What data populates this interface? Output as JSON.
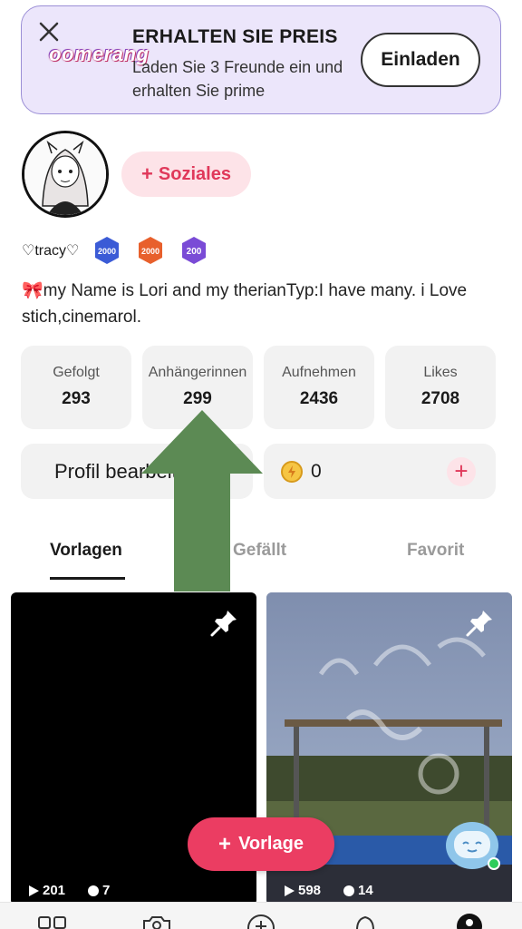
{
  "promo": {
    "logo_text": "oomerang",
    "title": "ERHALTEN SIE PREIS",
    "subtitle": "Laden Sie 3 Freunde ein und erhalten Sie prime",
    "button_label": "Einladen"
  },
  "profile": {
    "social_label": "Soziales",
    "username": "♡tracy♡",
    "badges": [
      {
        "label": "2000",
        "color": "#3b5bd6"
      },
      {
        "label": "2000",
        "color": "#e8602c"
      },
      {
        "label": "200",
        "color": "#7a4bd6"
      }
    ],
    "bio": "🎀my Name is Lori and my therianTyp:I have many. i Love stich,cinemarol."
  },
  "stats": [
    {
      "label": "Gefolgt",
      "value": "293"
    },
    {
      "label": "Anhängerinnen",
      "value": "299"
    },
    {
      "label": "Aufnehmen",
      "value": "2436"
    },
    {
      "label": "Likes",
      "value": "2708"
    }
  ],
  "actions": {
    "edit_label": "Profil bearbeiten",
    "coins": "0"
  },
  "tabs": [
    "Vorlagen",
    "Gefällt",
    "Favorit"
  ],
  "cards": [
    {
      "plays": "201",
      "comments": "7"
    },
    {
      "plays": "598",
      "comments": "14"
    }
  ],
  "fab_label": "Vorlage",
  "colors": {
    "accent": "#eb3d62",
    "promo_bg": "#ece6fb",
    "overlay_arrow": "#5c8a54"
  },
  "icons": {
    "nav": [
      "grid-icon",
      "camera-icon",
      "add-circle-icon",
      "bell-icon",
      "profile-icon"
    ]
  }
}
